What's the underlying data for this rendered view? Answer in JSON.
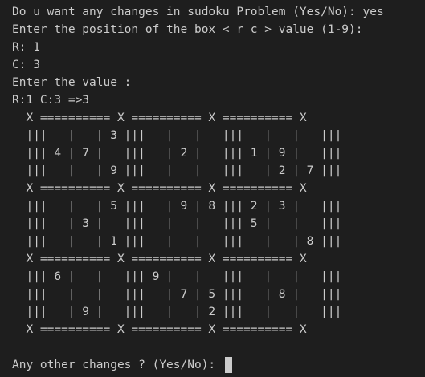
{
  "terminal": {
    "lines": [
      "Do u want any changes in sudoku Problem (Yes/No): yes",
      "Enter the position of the box < r c > value (1-9):",
      "R: 1",
      "C: 3",
      "Enter the value :",
      "R:1 C:3 =>3",
      "  X ========== X ========== X ========== X",
      "  |||   |   | 3 |||   |   |   |||   |   |   |||",
      "  ||| 4 | 7 |   |||   | 2 |   ||| 1 | 9 |   |||",
      "  |||   |   | 9 |||   |   |   |||   | 2 | 7 |||",
      "  X ========== X ========== X ========== X",
      "  |||   |   | 5 |||   | 9 | 8 ||| 2 | 3 |   |||",
      "  |||   | 3 |   |||   |   |   ||| 5 |   |   |||",
      "  |||   |   | 1 |||   |   |   |||   |   | 8 |||",
      "  X ========== X ========== X ========== X",
      "  ||| 6 |   |   ||| 9 |   |   |||   |   |   |||",
      "  |||   |   |   |||   | 7 | 5 |||   | 8 |   |||",
      "  |||   | 9 |   |||   |   | 2 |||   |   |   |||",
      "  X ========== X ========== X ========== X",
      "",
      "Any other changes ? (Yes/No): "
    ]
  }
}
